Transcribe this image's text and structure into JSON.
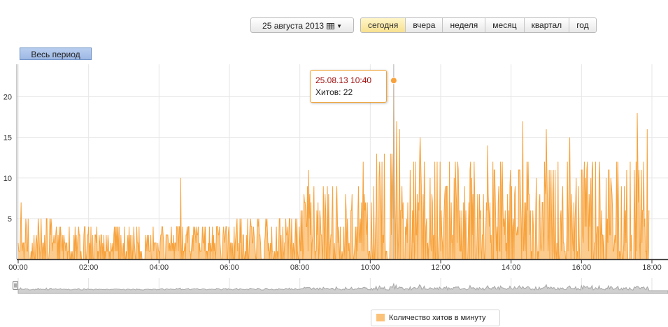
{
  "toolbar": {
    "date_label": "25 августа 2013",
    "periods": [
      {
        "label": "сегодня",
        "active": true
      },
      {
        "label": "вчера",
        "active": false
      },
      {
        "label": "неделя",
        "active": false
      },
      {
        "label": "месяц",
        "active": false
      },
      {
        "label": "квартал",
        "active": false
      },
      {
        "label": "год",
        "active": false
      }
    ],
    "whole_period_label": "Весь период"
  },
  "tooltip": {
    "time": "25.08.13 10:40",
    "value_label": "Хитов: 22"
  },
  "legend": {
    "label": "Количество хитов в минуту"
  },
  "colors": {
    "series": "#f7a23c",
    "series_fill": "#fbc27a",
    "navigator": "#a8a8a8",
    "active_period": "#f7e08f"
  },
  "chart_data": {
    "type": "area",
    "title": "",
    "xlabel": "",
    "ylabel": "",
    "x_ticks": [
      "00:00",
      "02:00",
      "04:00",
      "06:00",
      "08:00",
      "10:00",
      "12:00",
      "14:00",
      "16:00",
      "18:00"
    ],
    "y_ticks": [
      5,
      10,
      15,
      20
    ],
    "xlim": [
      "00:00",
      "18:00"
    ],
    "ylim": [
      0,
      24
    ],
    "grid": true,
    "legend_position": "bottom-center",
    "resolution": "1 minute",
    "series": [
      {
        "name": "Количество хитов в минуту",
        "segments": [
          {
            "from": "00:00",
            "to": "01:00",
            "typical_max": 5,
            "typical_mean": 2
          },
          {
            "from": "01:00",
            "to": "06:00",
            "typical_max": 4,
            "typical_mean": 1.5
          },
          {
            "from": "06:00",
            "to": "08:00",
            "typical_max": 5,
            "typical_mean": 2
          },
          {
            "from": "08:00",
            "to": "10:00",
            "typical_max": 9,
            "typical_mean": 3.5
          },
          {
            "from": "10:00",
            "to": "11:00",
            "typical_max": 13,
            "typical_mean": 5
          },
          {
            "from": "11:00",
            "to": "18:00",
            "typical_max": 12,
            "typical_mean": 5
          }
        ],
        "peaks": [
          {
            "time": "00:05",
            "value": 7
          },
          {
            "time": "04:37",
            "value": 10
          },
          {
            "time": "08:15",
            "value": 11
          },
          {
            "time": "09:48",
            "value": 12
          },
          {
            "time": "10:20",
            "value": 12
          },
          {
            "time": "10:35",
            "value": 13
          },
          {
            "time": "10:40",
            "value": 22
          },
          {
            "time": "10:45",
            "value": 17
          },
          {
            "time": "10:50",
            "value": 16
          },
          {
            "time": "11:25",
            "value": 15
          },
          {
            "time": "11:50",
            "value": 12
          },
          {
            "time": "12:30",
            "value": 11
          },
          {
            "time": "13:20",
            "value": 14
          },
          {
            "time": "13:45",
            "value": 12
          },
          {
            "time": "14:20",
            "value": 17
          },
          {
            "time": "15:00",
            "value": 16
          },
          {
            "time": "15:20",
            "value": 12
          },
          {
            "time": "15:40",
            "value": 15
          },
          {
            "time": "16:05",
            "value": 12
          },
          {
            "time": "16:30",
            "value": 10
          },
          {
            "time": "17:00",
            "value": 12
          },
          {
            "time": "17:35",
            "value": 18
          },
          {
            "time": "17:52",
            "value": 16
          }
        ],
        "highlighted": {
          "time": "10:40",
          "value": 22
        },
        "end": "17:55"
      }
    ]
  }
}
